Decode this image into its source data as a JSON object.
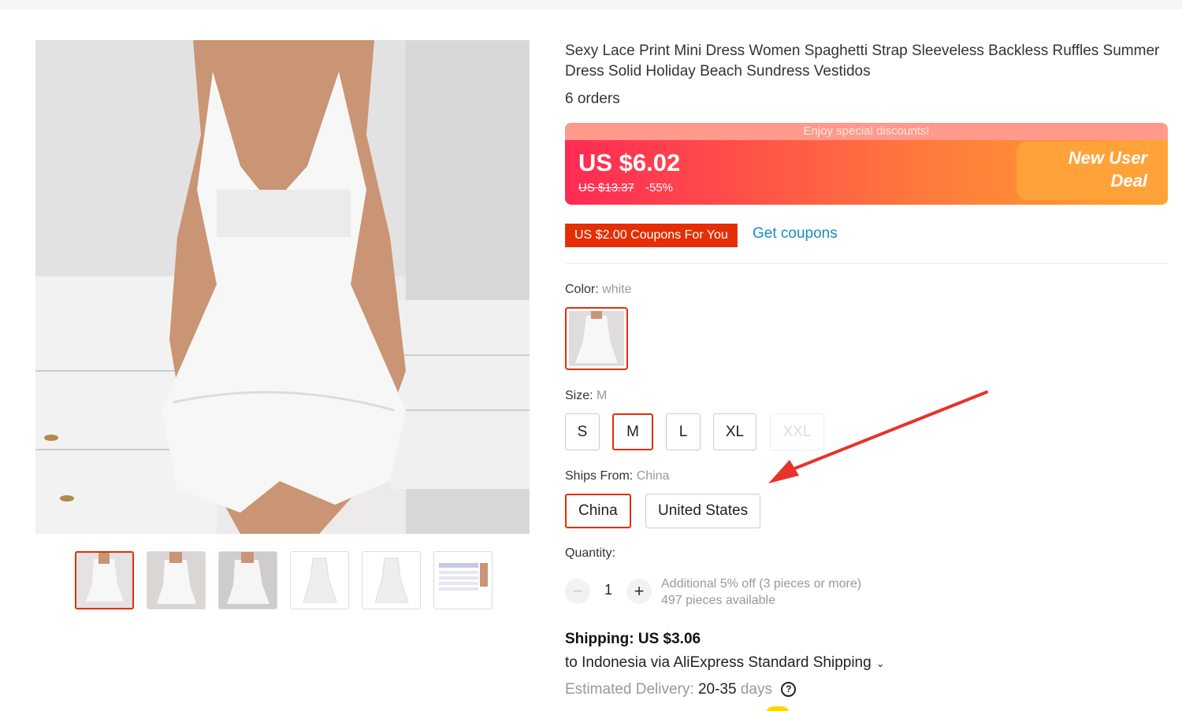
{
  "product": {
    "title": "Sexy Lace Print Mini Dress Women Spaghetti Strap Sleeveless Backless Ruffles Summer Dress Solid Holiday Beach Sundress Vestidos",
    "orders": "6 orders"
  },
  "gallery": {
    "main_image": "dress-photo",
    "thumbnails": [
      "dress-photo-1",
      "dress-photo-2",
      "dress-photo-3",
      "dress-front",
      "dress-back",
      "size-chart"
    ]
  },
  "price": {
    "promo_banner": "Enjoy special discounts!",
    "current": "US $6.02",
    "original": "US $13.37",
    "discount": "-55%",
    "new_user_deal": "New User Deal"
  },
  "coupon": {
    "label": "US $2.00 Coupons For You",
    "get_link": "Get coupons"
  },
  "color": {
    "label": "Color:",
    "value": "white"
  },
  "size": {
    "label": "Size:",
    "value": "M",
    "options": [
      "S",
      "M",
      "L",
      "XL",
      "XXL"
    ]
  },
  "ships_from": {
    "label": "Ships From:",
    "value": "China",
    "options": [
      "China",
      "United States"
    ]
  },
  "quantity": {
    "label": "Quantity:",
    "value": "1",
    "minus": "−",
    "plus": "+",
    "additional_off": "Additional 5% off (3 pieces or more)",
    "available": "497 pieces available"
  },
  "shipping": {
    "price": "Shipping: US $3.06",
    "to": "to Indonesia via AliExpress Standard Shipping",
    "est_label": "Estimated Delivery:",
    "est_days": "20-35",
    "days_word": "days"
  },
  "colors": {
    "accent_red": "#e62e04",
    "link_blue": "#1a8cbf",
    "annotation_arrow": "#e8322a"
  }
}
